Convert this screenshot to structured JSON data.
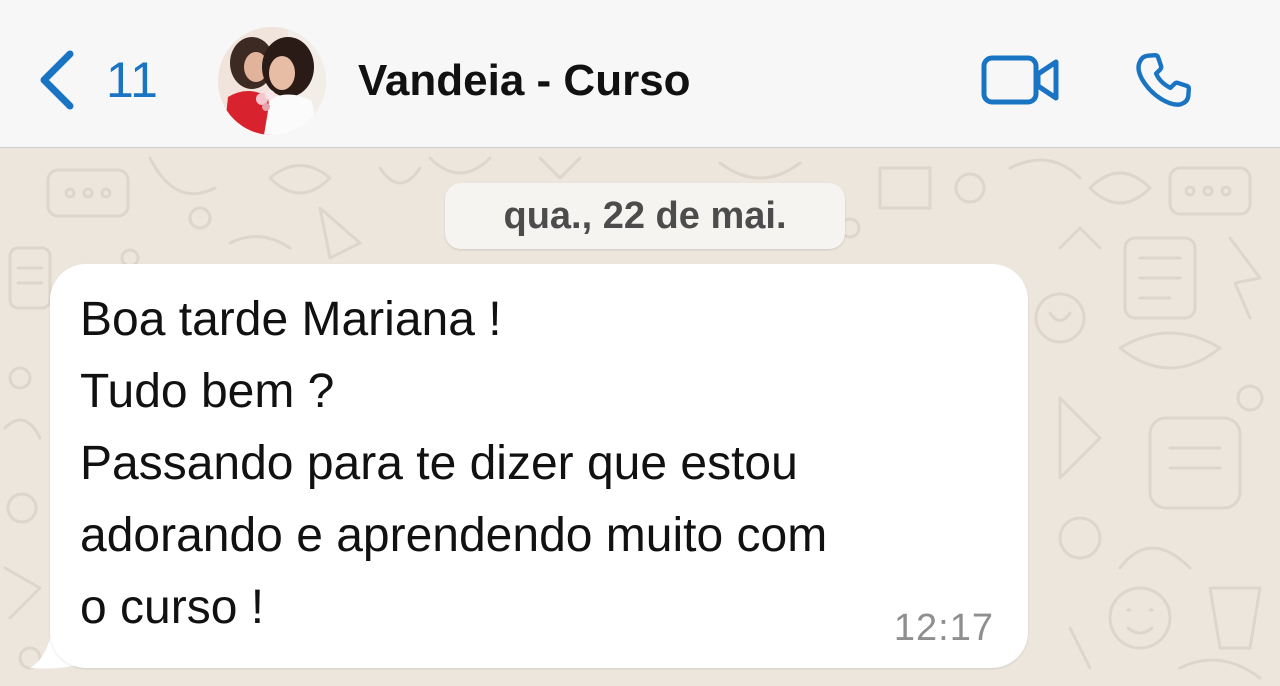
{
  "header": {
    "back_count": "11",
    "contact_name": "Vandeia - Curso",
    "icons": {
      "back": "chevron-left-icon",
      "video": "video-camera-icon",
      "phone": "phone-icon"
    },
    "accent_color": "#1a74c4"
  },
  "chat": {
    "date_label": "qua., 22 de mai.",
    "messages": [
      {
        "text": "Boa tarde Mariana !\nTudo bem ?\nPassando para te dizer que estou\nadorando e aprendendo muito com\no curso !",
        "time": "12:17",
        "direction": "incoming"
      }
    ],
    "bubble_color": "#ffffff",
    "wallpaper_color": "#ece6dd"
  }
}
